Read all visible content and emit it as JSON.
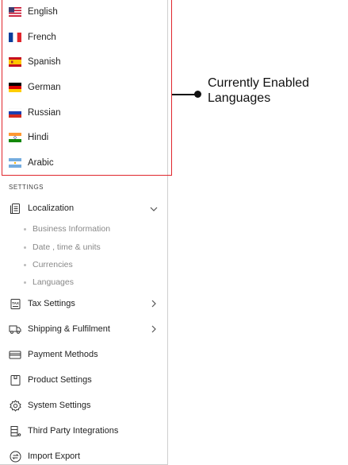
{
  "languages": [
    {
      "label": "English",
      "flag": "us-flag-icon"
    },
    {
      "label": "French",
      "flag": "france-flag-icon"
    },
    {
      "label": "Spanish",
      "flag": "spain-flag-icon"
    },
    {
      "label": "German",
      "flag": "germany-flag-icon"
    },
    {
      "label": "Russian",
      "flag": "russia-flag-icon"
    },
    {
      "label": "Hindi",
      "flag": "india-flag-icon"
    },
    {
      "label": "Arabic",
      "flag": "argentina-flag-icon"
    }
  ],
  "settings": {
    "heading": "SETTINGS",
    "localization": {
      "label": "Localization",
      "sub_items": [
        "Business Information",
        "Date , time & units",
        "Currencies",
        "Languages"
      ]
    },
    "items": [
      {
        "label": "Tax Settings",
        "icon": "tax-document-icon",
        "has_chevron": true
      },
      {
        "label": "Shipping & Fulfilment",
        "icon": "truck-icon",
        "has_chevron": true
      },
      {
        "label": "Payment Methods",
        "icon": "credit-card-icon",
        "has_chevron": false
      },
      {
        "label": "Product Settings",
        "icon": "box-icon",
        "has_chevron": false
      },
      {
        "label": "System Settings",
        "icon": "gear-icon",
        "has_chevron": false
      },
      {
        "label": "Third Party Integrations",
        "icon": "integrations-icon",
        "has_chevron": false
      },
      {
        "label": "Import Export",
        "icon": "import-export-icon",
        "has_chevron": false
      }
    ]
  },
  "callout": {
    "text_line1": "Currently Enabled",
    "text_line2": "Languages"
  },
  "colors": {
    "highlight_border": "#e0262d",
    "accent": "#111111"
  }
}
